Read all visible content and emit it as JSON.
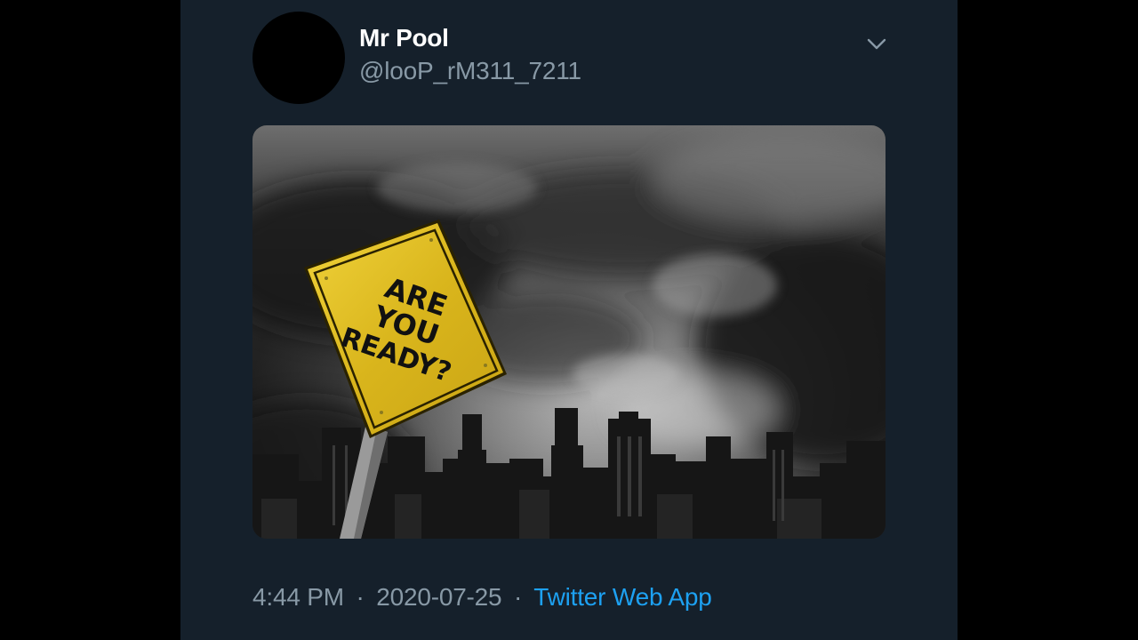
{
  "tweet": {
    "display_name": "Mr Pool",
    "handle": "@looP_rM311_7211",
    "time": "4:44 PM",
    "separator": "·",
    "date": "2020-07-25",
    "source": "Twitter Web App",
    "more_icon": "chevron-down-icon"
  },
  "media": {
    "sign_text_lines": [
      "ARE",
      "YOU",
      "READY?"
    ]
  },
  "colors": {
    "background": "#15202b",
    "name": "#ffffff",
    "secondary_text": "#8899a6",
    "link": "#1da1f2",
    "sign_yellow": "#e8c21e"
  }
}
